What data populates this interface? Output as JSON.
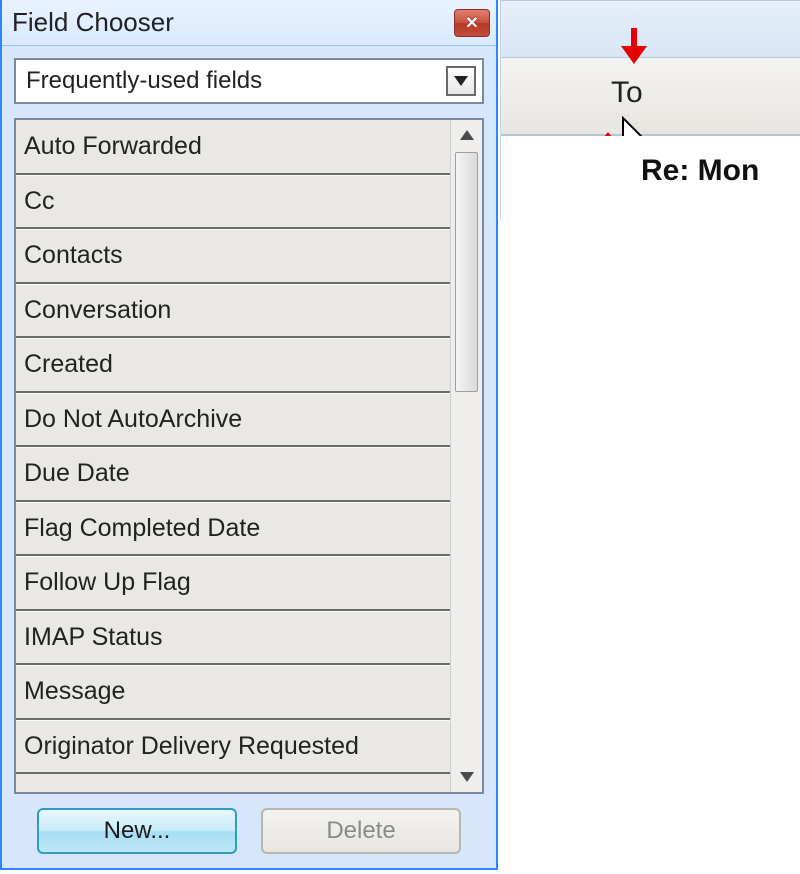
{
  "dialog": {
    "title": "Field Chooser",
    "category_selected": "Frequently-used fields",
    "fields": [
      "Auto Forwarded",
      "Cc",
      "Contacts",
      "Conversation",
      "Created",
      "Do Not AutoArchive",
      "Due Date",
      "Flag Completed Date",
      "Follow Up Flag",
      "IMAP Status",
      "Message",
      "Originator Delivery Requested"
    ],
    "buttons": {
      "new": "New...",
      "delete": "Delete"
    }
  },
  "preview": {
    "column_label": "To",
    "message_subject": "Re: Mon"
  }
}
